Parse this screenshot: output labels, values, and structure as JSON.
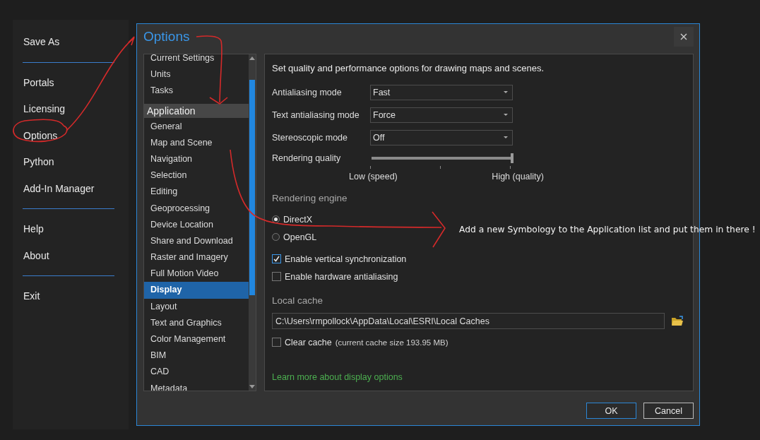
{
  "backstage": {
    "groups": [
      [
        "Save As"
      ],
      [
        "Portals",
        "Licensing",
        "Options",
        "Python",
        "Add-In Manager"
      ],
      [
        "Help",
        "About"
      ],
      [
        "Exit"
      ]
    ]
  },
  "dialog": {
    "title": "Options",
    "nav": {
      "items": [
        {
          "label": "Current Settings",
          "kind": "item",
          "selected": false
        },
        {
          "label": "Units",
          "kind": "item",
          "selected": false
        },
        {
          "label": "Tasks",
          "kind": "item",
          "selected": false
        },
        {
          "label": "Application",
          "kind": "header",
          "selected": false
        },
        {
          "label": "General",
          "kind": "item",
          "selected": false
        },
        {
          "label": "Map and Scene",
          "kind": "item",
          "selected": false
        },
        {
          "label": "Navigation",
          "kind": "item",
          "selected": false
        },
        {
          "label": "Selection",
          "kind": "item",
          "selected": false
        },
        {
          "label": "Editing",
          "kind": "item",
          "selected": false
        },
        {
          "label": "Geoprocessing",
          "kind": "item",
          "selected": false
        },
        {
          "label": "Device Location",
          "kind": "item",
          "selected": false
        },
        {
          "label": "Share and Download",
          "kind": "item",
          "selected": false
        },
        {
          "label": "Raster and Imagery",
          "kind": "item",
          "selected": false
        },
        {
          "label": "Full Motion Video",
          "kind": "item",
          "selected": false
        },
        {
          "label": "Display",
          "kind": "item",
          "selected": true
        },
        {
          "label": "Layout",
          "kind": "item",
          "selected": false
        },
        {
          "label": "Text and Graphics",
          "kind": "item",
          "selected": false
        },
        {
          "label": "Color Management",
          "kind": "item",
          "selected": false
        },
        {
          "label": "BIM",
          "kind": "item",
          "selected": false
        },
        {
          "label": "CAD",
          "kind": "item",
          "selected": false
        },
        {
          "label": "Metadata",
          "kind": "item",
          "selected": false
        }
      ]
    },
    "panel": {
      "heading": "Set quality and performance options for drawing maps and scenes.",
      "fields": [
        {
          "label": "Antialiasing mode",
          "value": "Fast"
        },
        {
          "label": "Text antialiasing mode",
          "value": "Force"
        },
        {
          "label": "Stereoscopic mode",
          "value": "Off"
        }
      ],
      "slider": {
        "label": "Rendering quality",
        "level": 1,
        "min_label": "Low (speed)",
        "max_label": "High (quality)"
      },
      "engine": {
        "title": "Rendering engine",
        "options": [
          {
            "label": "DirectX",
            "selected": true
          },
          {
            "label": "OpenGL",
            "selected": false
          }
        ]
      },
      "checkboxes": [
        {
          "label": "Enable vertical synchronization",
          "checked": true
        },
        {
          "label": "Enable hardware antialiasing",
          "checked": false
        }
      ],
      "cache": {
        "title": "Local cache",
        "path": "C:\\Users\\rmpollock\\AppData\\Local\\ESRI\\Local Caches",
        "clear": {
          "label": "Clear cache",
          "note": "(current cache size 193.95 MB)",
          "checked": false
        }
      },
      "link": "Learn more about display options"
    },
    "buttons": [
      {
        "label": "OK",
        "default": true
      },
      {
        "label": "Cancel",
        "default": false
      }
    ]
  },
  "annotation": {
    "text": "Add a new Symbology to the Application list and put them in there !"
  }
}
